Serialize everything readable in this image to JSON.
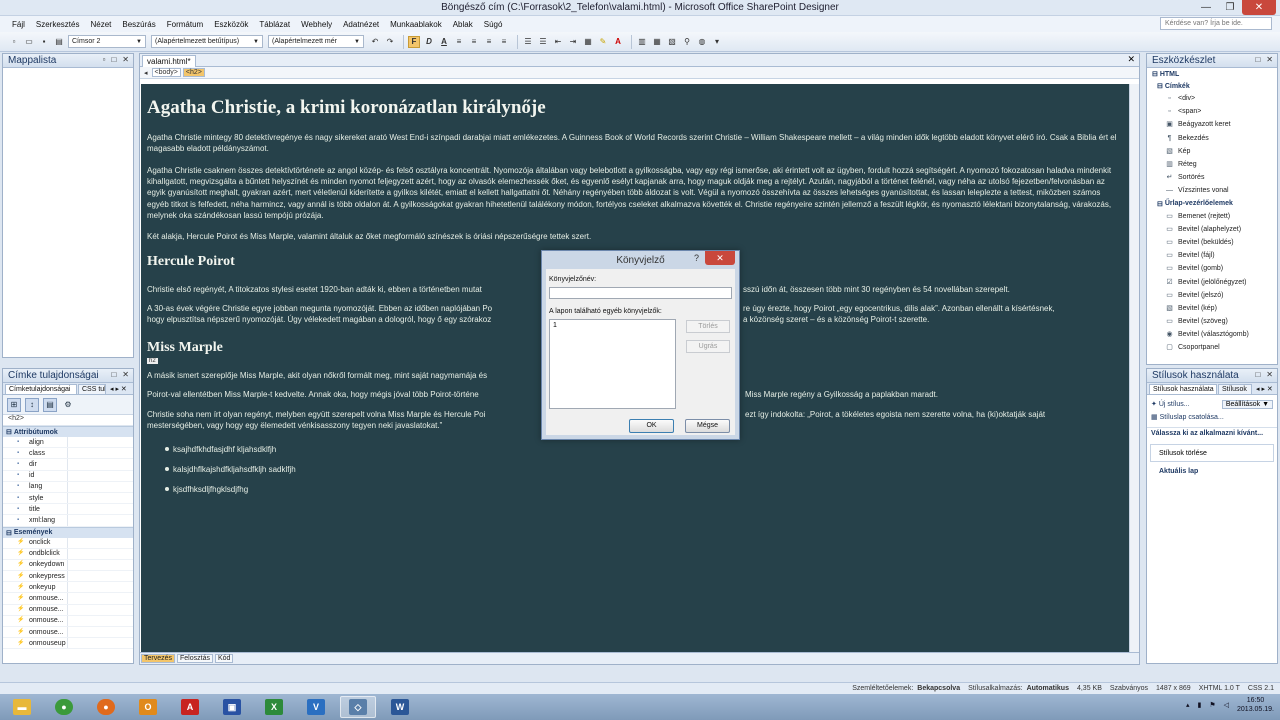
{
  "window": {
    "title": "Böngésző cím (C:\\Forrasok\\2_Telefon\\valami.html) - Microsoft Office SharePoint Designer"
  },
  "menu": [
    "Fájl",
    "Szerkesztés",
    "Nézet",
    "Beszúrás",
    "Formátum",
    "Eszközök",
    "Táblázat",
    "Webhely",
    "Adatnézet",
    "Munkaablakok",
    "Ablak",
    "Súgó"
  ],
  "help_placeholder": "Kérdése van? Írja be ide.",
  "toolbar": {
    "style": "Címsor 2",
    "font": "(Alapértelmezett betűtípus)",
    "size": "(Alapértelmezett mér"
  },
  "mappalista": {
    "title": "Mappalista"
  },
  "cimke": {
    "title": "Címke tulajdonságai",
    "tabs": [
      "Címketulajdonságai",
      "CSS tula"
    ],
    "tag": "<h2>",
    "sec_attr": "Attribútumok",
    "attrs": [
      "align",
      "class",
      "dir",
      "id",
      "lang",
      "style",
      "title",
      "xml:lang"
    ],
    "sec_events": "Események",
    "events": [
      "onclick",
      "ondblclick",
      "onkeydown",
      "onkeypress",
      "onkeyup",
      "onmouse...",
      "onmouse...",
      "onmouse...",
      "onmouse...",
      "onmouseup"
    ]
  },
  "editor": {
    "tab": "valami.html*",
    "crumbs": [
      "<body>",
      "<h2>"
    ],
    "h1": "Agatha Christie, a krimi koronázatlan királynője",
    "p1": "Agatha Christie mintegy 80 detektívregénye és nagy sikereket arató West End-i színpadi darabjai miatt emlékezetes. A Guinness Book of World Records szerint Christie – William Shakespeare mellett – a világ minden idők legtöbb eladott könyvet elérő író. Csak a Biblia ért el magasabb eladott példányszámot.",
    "p2": "Agatha Christie csaknem összes detektívtörténete az angol közép- és felső osztályra koncentrált. Nyomozója általában vagy belebotlott a gyilkosságba, vagy egy régi ismerőse, aki érintett volt az ügyben, fordult hozzá segítségért. A nyomozó fokozatosan haladva mindenkit kihallgatott, megvizsgálta a bűntett helyszínét és minden nyomot feljegyzett azért, hogy az olvasók elemezhessék őket, és egyenlő esélyt kapjanak arra, hogy maguk oldják meg a rejtélyt. Azután, nagyjából a történet felénél, vagy néha az utolsó fejezetben/felvonásban az egyik gyanúsított meghalt, gyakran azért, mert véletlenül kiderítette a gyilkos kilétét, emiatt el kellett hallgattatni őt. Néhány regényében több áldozat is volt. Végül a nyomozó összehívta az összes lehetséges gyanúsítottat, és lassan leleplezte a tettest, miközben számos egyéb titkot is felfedett, néha harmincz, vagy annál is több oldalon át. A gyilkosságokat gyakran hihetetlenül találékony módon, fortélyos cseleket alkalmazva követték el. Christie regényeire szintén jellemző a feszült légkör, és nyomasztó lélektani bizonytalanság, várakozás, melynek oka szándékosan lassú tempójú prózája.",
    "p3": "Két alakja, Hercule Poirot és Miss Marple, valamint általuk az őket megformáló színészek is óriási népszerűségre tettek szert.",
    "h2a": "Hercule Poirot",
    "p4a": "Christie első regényét, A titokzatos stylesi esetet 1920-ban adták ki, ebben a történetben mutat",
    "p4b": "sszú időn át, összesen több mint 30 regényben és 54 novellában szerepelt.",
    "p5a": "A 30-as évek végére Christie egyre jobban megunta nyomozóját. Ebben az időben naplójában Po",
    "p5b": "re úgy érezte, hogy Poirot „egy egocentrikus, dilis alak”. Azonban ellenállt a kísértésnek,",
    "p5c": "hogy elpusztítsa népszerű nyomozóját. Úgy vélekedett magában a dologról, hogy ő egy szórakoz",
    "p5d": "a közönség szeret – és a közönség Poirot-t szerette.",
    "h2tag": "h2",
    "h2b": "Miss Marple",
    "p6": "A másik ismert szereplője Miss Marple, akit olyan nőkről formált meg, mint saját nagymamája és",
    "p7a": "Poirot-val ellentétben Miss Marple-t kedvelte. Annak oka, hogy mégis jóval több Poirot-történe",
    "p7b": "Miss Marple regény a Gyilkosság a paplakban maradt.",
    "p8a": "Christie soha nem írt olyan regényt, melyben együtt szerepelt volna Miss Marple és Hercule Poi",
    "p8b": "ezt így indokolta: „Poirot, a tökéletes egoista nem szerette volna, ha (ki)oktatják saját",
    "p8c": "mesterségében, vagy hogy egy ëlemedett vénkisasszony tegyen neki javaslatokat.”",
    "list": [
      "ksajhdfkhdfasjdhf kljahsdklfjh",
      "kalsjdhflkajshdfkljahsdfkljh sadklfjh",
      "kjsdfhksdljfhgklsdjfhg"
    ],
    "view_tabs": [
      "Tervezés",
      "Felosztás",
      "Kód"
    ]
  },
  "dialog": {
    "title": "Könyvjelző",
    "name_label": "Könyvjelzőnév:",
    "list_label": "A lapon található egyéb könyvjelzők:",
    "list_item": "1",
    "delete": "Törlés",
    "goto": "Ugrás",
    "ok": "OK",
    "cancel": "Mégse"
  },
  "eszkoz": {
    "title": "Eszközkészlet",
    "html": "HTML",
    "sec_tags": "Címkék",
    "tags": [
      "<div>",
      "<span>",
      "Beágyazott keret",
      "Bekezdés",
      "Kép",
      "Réteg",
      "Sortörés",
      "Vízszintes vonal"
    ],
    "sec_form": "Űrlap-vezérlőelemek",
    "form": [
      "Bemenet (rejtett)",
      "Bevitel (alaphelyzet)",
      "Bevitel (beküldés)",
      "Bevitel (fájl)",
      "Bevitel (gomb)",
      "Bevitel (jelölőnégyzet)",
      "Bevitel (jelszó)",
      "Bevitel (kép)",
      "Bevitel (szöveg)",
      "Bevitel (választógomb)",
      "Csoportpanel"
    ]
  },
  "stilus": {
    "title": "Stílusok használata",
    "tabs": [
      "Stílusok használata",
      "Stílusok"
    ],
    "new_style": "Új stílus...",
    "attach": "Stíluslap csatolása...",
    "settings": "Beállítások",
    "choose": "Válassza ki az alkalmazni kívánt...",
    "clear": "Stílusok törlése",
    "current": "Aktuális lap"
  },
  "status": {
    "mode_label": "Szemléltetőelemek:",
    "mode": "Bekapcsolva",
    "apply_label": "Stílusalkalmazás:",
    "apply": "Automatikus",
    "size": "4,35 KB",
    "std": "Szabványos",
    "dims": "1487 x 869",
    "xhtml": "XHTML 1.0 T",
    "css": "CSS 2.1"
  },
  "clock": {
    "time": "16:50",
    "date": "2013.05.19."
  }
}
